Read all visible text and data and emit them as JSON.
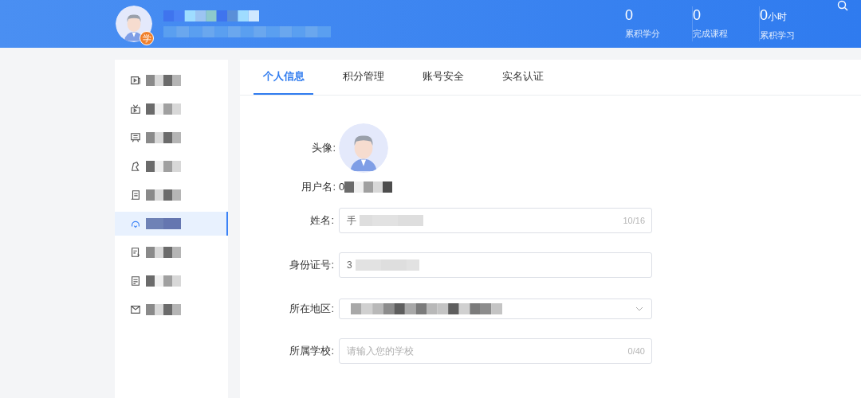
{
  "header": {
    "badge": "学",
    "stats": [
      {
        "value": "0",
        "label": "累积学分"
      },
      {
        "value": "0",
        "label": "完成课程"
      },
      {
        "value": "0",
        "unit": "小时",
        "label": "累积学习"
      }
    ]
  },
  "sidebar": {
    "items": [
      {
        "selected": false
      },
      {
        "selected": false
      },
      {
        "selected": false
      },
      {
        "selected": false
      },
      {
        "selected": false
      },
      {
        "selected": true
      },
      {
        "selected": false
      },
      {
        "selected": false
      },
      {
        "selected": false
      }
    ]
  },
  "tabs": [
    {
      "label": "个人信息",
      "selected": true
    },
    {
      "label": "积分管理",
      "selected": false
    },
    {
      "label": "账号安全",
      "selected": false
    },
    {
      "label": "实名认证",
      "selected": false
    }
  ],
  "form": {
    "avatar_label": "头像:",
    "username_label": "用户名:",
    "username": "0",
    "fields": [
      {
        "kind": "text",
        "label": "姓名:",
        "value": "手",
        "counter": "10/16"
      },
      {
        "kind": "text",
        "label": "身份证号:",
        "value": "3"
      },
      {
        "kind": "select",
        "label": "所在地区:"
      },
      {
        "kind": "text",
        "label": "所属学校:",
        "placeholder": "请输入您的学校",
        "counter": "0/40"
      }
    ]
  }
}
